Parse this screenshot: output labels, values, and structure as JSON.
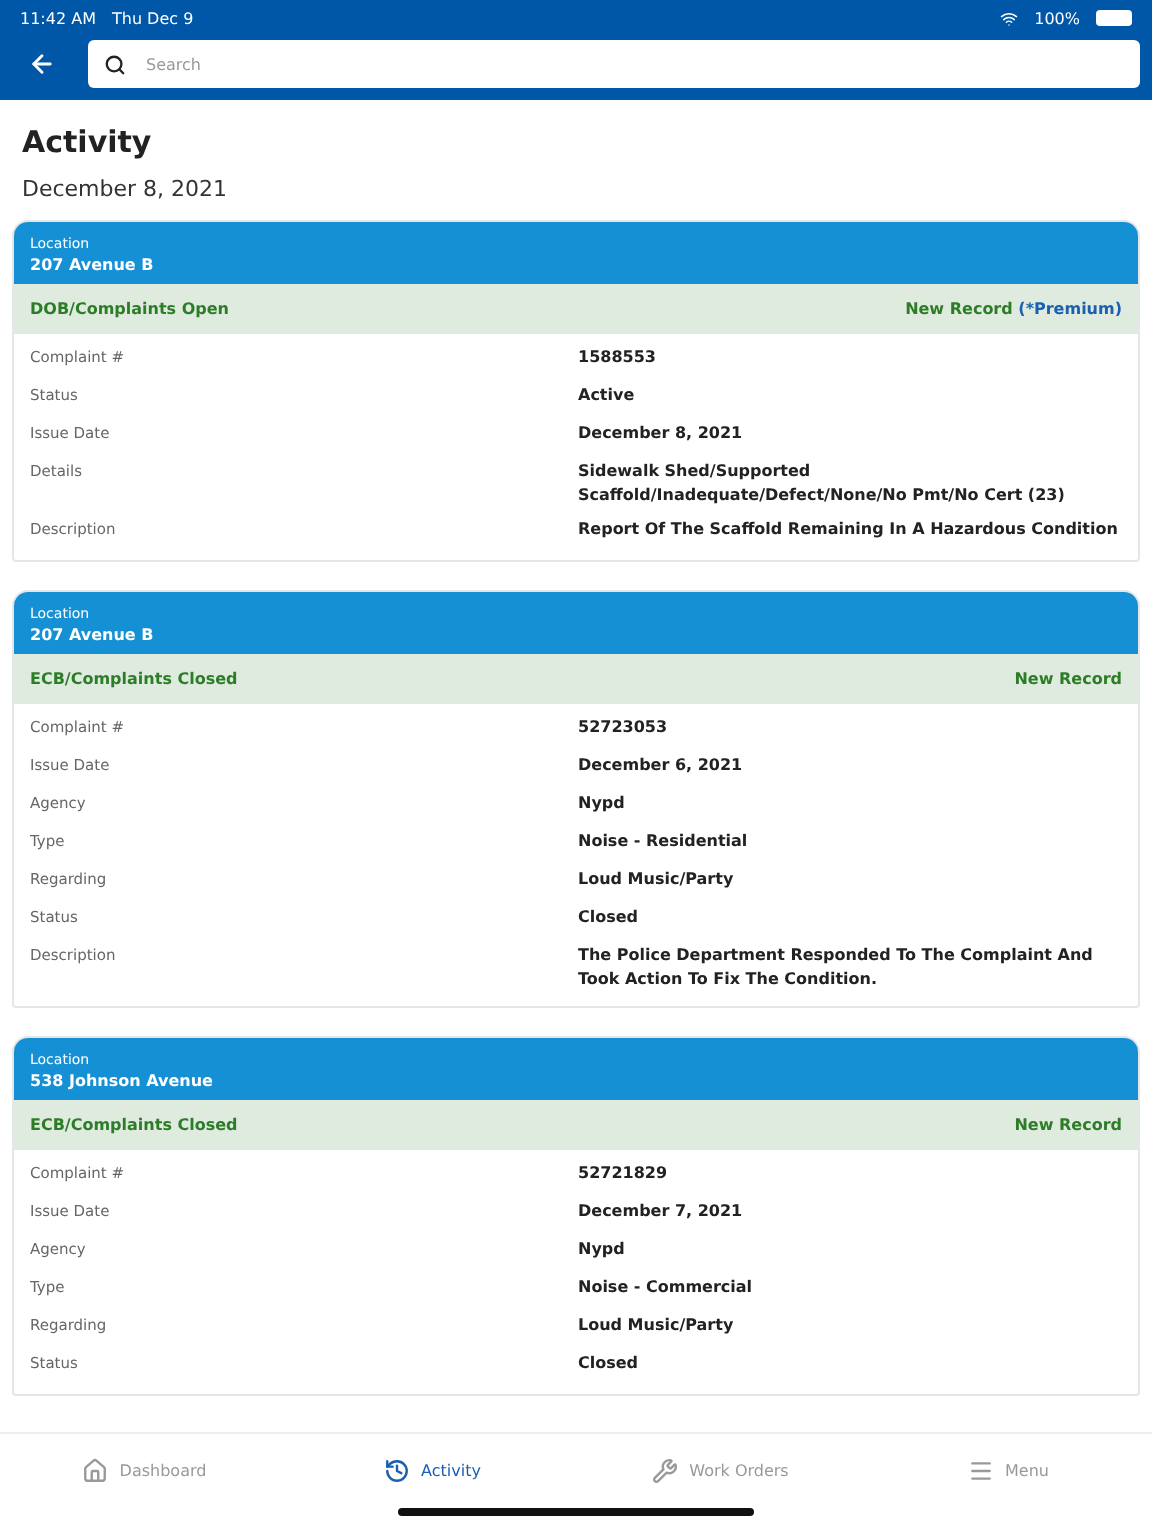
{
  "status_bar": {
    "time": "11:42 AM",
    "date": "Thu Dec 9",
    "battery": "100%"
  },
  "search": {
    "placeholder": "Search"
  },
  "page_title": "Activity",
  "date_heading": "December 8, 2021",
  "records": [
    {
      "location_label": "Location",
      "location": "207 Avenue B",
      "category": "DOB/Complaints Open",
      "badge": "New Record",
      "badge_note": "(*Premium)",
      "fields": [
        {
          "label": "Complaint #",
          "value": "1588553"
        },
        {
          "label": "Status",
          "value": "Active"
        },
        {
          "label": "Issue Date",
          "value": "December 8, 2021"
        },
        {
          "label": "Details",
          "value": "Sidewalk Shed/Supported Scaffold/Inadequate/Defect/None/No Pmt/No Cert (23)"
        },
        {
          "label": "Description",
          "value": "Report Of The Scaffold Remaining In A Hazardous Condition"
        }
      ]
    },
    {
      "location_label": "Location",
      "location": "207 Avenue B",
      "category": "ECB/Complaints Closed",
      "badge": "New Record",
      "fields": [
        {
          "label": "Complaint #",
          "value": "52723053"
        },
        {
          "label": "Issue Date",
          "value": "December 6, 2021"
        },
        {
          "label": "Agency",
          "value": "Nypd"
        },
        {
          "label": "Type",
          "value": "Noise - Residential"
        },
        {
          "label": "Regarding",
          "value": "Loud Music/Party"
        },
        {
          "label": "Status",
          "value": "Closed"
        },
        {
          "label": "Description",
          "value": "The Police Department Responded To The Complaint And Took Action To Fix The Condition."
        }
      ]
    },
    {
      "location_label": "Location",
      "location": "538 Johnson Avenue",
      "category": "ECB/Complaints Closed",
      "badge": "New Record",
      "fields": [
        {
          "label": "Complaint #",
          "value": "52721829"
        },
        {
          "label": "Issue Date",
          "value": "December 7, 2021"
        },
        {
          "label": "Agency",
          "value": "Nypd"
        },
        {
          "label": "Type",
          "value": "Noise - Commercial"
        },
        {
          "label": "Regarding",
          "value": "Loud Music/Party"
        },
        {
          "label": "Status",
          "value": "Closed"
        }
      ]
    }
  ],
  "tab_bar": [
    {
      "kind": "home",
      "label": "Dashboard",
      "selected": false
    },
    {
      "kind": "history",
      "label": "Activity",
      "selected": true
    },
    {
      "kind": "tools",
      "label": "Work Orders",
      "selected": false
    },
    {
      "kind": "menu",
      "label": "Menu",
      "selected": false
    }
  ]
}
